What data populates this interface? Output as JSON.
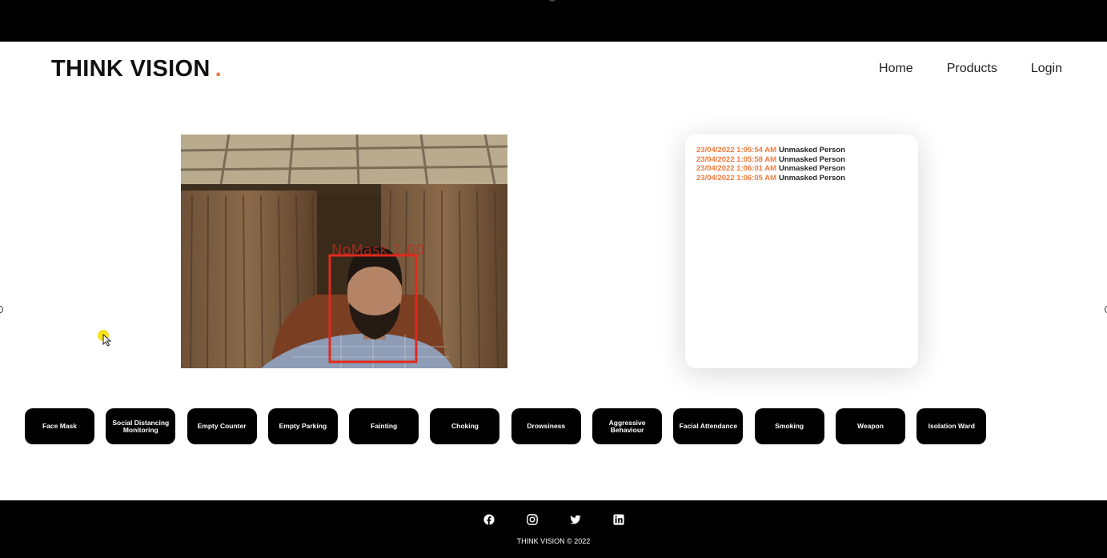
{
  "brand": {
    "name": "THINK VISION",
    "accent": "."
  },
  "nav": {
    "links": [
      {
        "label": "Home"
      },
      {
        "label": "Products"
      },
      {
        "label": "Login"
      }
    ]
  },
  "video": {
    "detection_label": "NoMask 1.00"
  },
  "log": {
    "entries": [
      {
        "time": "23/04/2022 1:05:54 AM",
        "message": "Unmasked Person"
      },
      {
        "time": "23/04/2022 1:05:58 AM",
        "message": "Unmasked Person"
      },
      {
        "time": "23/04/2022 1:06:01 AM",
        "message": "Unmasked Person"
      },
      {
        "time": "23/04/2022 1:06:05 AM",
        "message": "Unmasked Person"
      }
    ]
  },
  "features": [
    {
      "label": "Face Mask"
    },
    {
      "label": "Social Distancing Monitoring"
    },
    {
      "label": "Empty Counter"
    },
    {
      "label": "Empty Parking"
    },
    {
      "label": "Fainting"
    },
    {
      "label": "Choking"
    },
    {
      "label": "Drowsiness"
    },
    {
      "label": "Aggressive Behaviour"
    },
    {
      "label": "Facial Attendance"
    },
    {
      "label": "Smoking"
    },
    {
      "label": "Weapon"
    },
    {
      "label": "Isolation Ward"
    }
  ],
  "footer": {
    "icons": [
      "facebook-icon",
      "instagram-icon",
      "twitter-icon",
      "linkedin-icon"
    ],
    "copyright": "THINK VISION © 2022"
  },
  "colors": {
    "accent": "#f07b3f",
    "detection_box": "#e02a1e",
    "button_bg": "#000000"
  }
}
